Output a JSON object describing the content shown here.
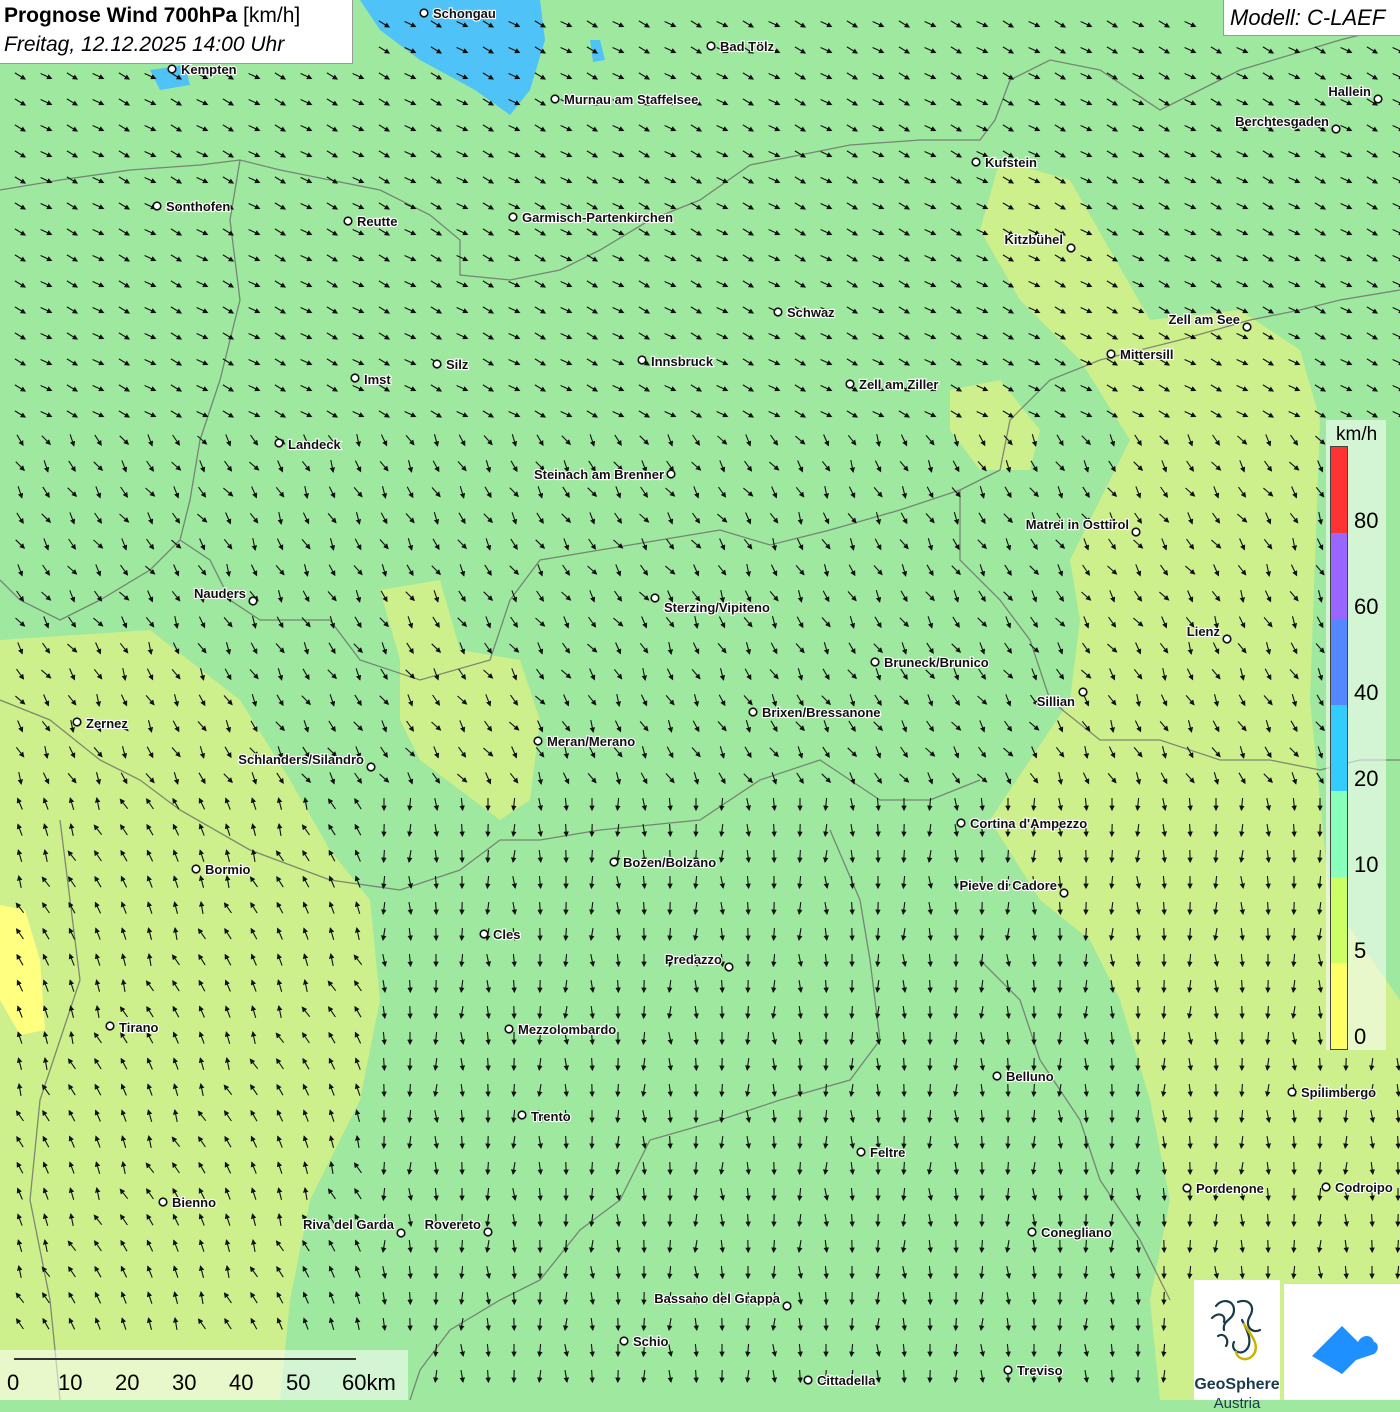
{
  "header": {
    "title_bold": "Prognose Wind 700hPa",
    "title_unit": "[km/h]",
    "date": "Freitag, 12.12.2025 14:00 Uhr",
    "model": "Modell: C-LAEF"
  },
  "legend": {
    "unit": "km/h",
    "labels": [
      "80",
      "60",
      "40",
      "20",
      "10",
      "5",
      "0"
    ],
    "colors": [
      "#ff3333",
      "#9966ff",
      "#5588ff",
      "#33ccff",
      "#88ffbb",
      "#ccff66",
      "#ffff66"
    ]
  },
  "scale": {
    "labels": [
      "0",
      "10",
      "20",
      "30",
      "40",
      "50",
      "60km"
    ]
  },
  "colors": {
    "base_green": "#9fe89f",
    "yellow_green": "#d2f08a",
    "lake": "#4fc3f7"
  },
  "cities": [
    {
      "name": "Schongau"
    },
    {
      "name": "Bad Tölz"
    },
    {
      "name": "Kempten"
    },
    {
      "name": "Murnau am Staffelsee"
    },
    {
      "name": "Hallein"
    },
    {
      "name": "Berchtesgaden"
    },
    {
      "name": "Kufstein"
    },
    {
      "name": "Sonthofen"
    },
    {
      "name": "Reutte"
    },
    {
      "name": "Garmisch-Partenkirchen"
    },
    {
      "name": "Kitzbühel"
    },
    {
      "name": "Schwaz"
    },
    {
      "name": "Zell am See"
    },
    {
      "name": "Silz"
    },
    {
      "name": "Innsbruck"
    },
    {
      "name": "Mittersill"
    },
    {
      "name": "Imst"
    },
    {
      "name": "Zell am Ziller"
    },
    {
      "name": "Landeck"
    },
    {
      "name": "Steinach am Brenner"
    },
    {
      "name": "Matrei in Osttirol"
    },
    {
      "name": "Nauders"
    },
    {
      "name": "Sterzing/Vipiteno"
    },
    {
      "name": "Lienz"
    },
    {
      "name": "Bruneck/Brunico"
    },
    {
      "name": "Sillian"
    },
    {
      "name": "Brixen/Bressanone"
    },
    {
      "name": "Zernez"
    },
    {
      "name": "Meran/Merano"
    },
    {
      "name": "Schlanders/Silandro"
    },
    {
      "name": "Cortina d'Ampezzo"
    },
    {
      "name": "Bozen/Bolzano"
    },
    {
      "name": "Bormio"
    },
    {
      "name": "Pieve di Cadore"
    },
    {
      "name": "Cles"
    },
    {
      "name": "Predazzo"
    },
    {
      "name": "Tirano"
    },
    {
      "name": "Mezzolombardo"
    },
    {
      "name": "Belluno"
    },
    {
      "name": "Spilimbergo"
    },
    {
      "name": "Trento"
    },
    {
      "name": "Feltre"
    },
    {
      "name": "Bienno"
    },
    {
      "name": "Pordenone"
    },
    {
      "name": "Codroipo"
    },
    {
      "name": "Riva del Garda"
    },
    {
      "name": "Rovereto"
    },
    {
      "name": "Conegliano"
    },
    {
      "name": "Bassano del Grappa"
    },
    {
      "name": "Schio"
    },
    {
      "name": "Treviso"
    },
    {
      "name": "Cittadella"
    }
  ],
  "logo": {
    "org_name": "GeoSphere",
    "org_sub": "Austria"
  },
  "icons": [
    "wind-arrow-icon",
    "city-dot-icon",
    "geosphere-logo-icon",
    "app-logo-icon"
  ]
}
